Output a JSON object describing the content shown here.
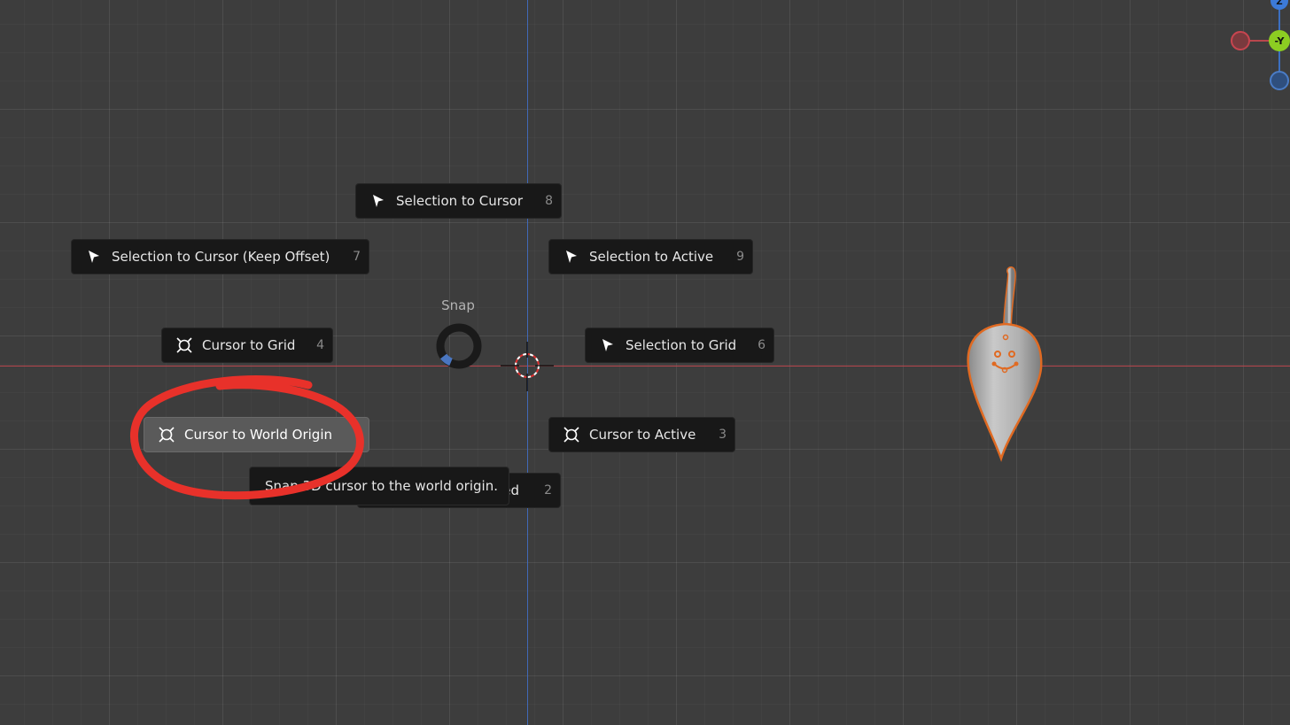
{
  "pie_menu": {
    "title": "Snap",
    "items": [
      {
        "label": "Selection to Cursor",
        "shortcut": "8",
        "icon": "selection-arrow-icon"
      },
      {
        "label": "Selection to Cursor (Keep Offset)",
        "shortcut": "7",
        "icon": "selection-arrow-icon"
      },
      {
        "label": "Selection to Active",
        "shortcut": "9",
        "icon": "selection-arrow-icon"
      },
      {
        "label": "Cursor to Grid",
        "shortcut": "4",
        "icon": "cursor-snap-icon"
      },
      {
        "label": "Selection to Grid",
        "shortcut": "6",
        "icon": "selection-arrow-icon"
      },
      {
        "label": "Cursor to World Origin",
        "shortcut": "",
        "icon": "cursor-snap-icon",
        "highlighted": true
      },
      {
        "label": "Cursor to Active",
        "shortcut": "3",
        "icon": "cursor-snap-icon"
      },
      {
        "label": "ed",
        "shortcut": "2",
        "icon": ""
      }
    ]
  },
  "tooltip": {
    "text": "Snap 3D cursor to the world origin."
  },
  "gizmo": {
    "top_label": "Z",
    "center_label": "-Y"
  },
  "colors": {
    "x_axis": "#b8474d",
    "y_axis": "#4169b8",
    "highlight_ring": "#e8312a",
    "selection_outline": "#e06a22"
  }
}
